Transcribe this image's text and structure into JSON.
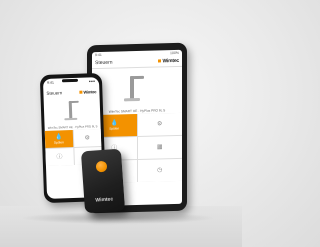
{
  "brand": {
    "name": "Wimtec",
    "accent": "#f39200"
  },
  "tablet": {
    "status_time": "9:41",
    "status_right": "100%",
    "title": "Steuern",
    "caption": "WimTec SMART HE · HyPlus PRO 6L S",
    "tiles": [
      {
        "label": "Spülen",
        "icon": "drop-icon"
      },
      {
        "label": "",
        "icon": "settings-icon"
      },
      {
        "label": "",
        "icon": "info-icon"
      },
      {
        "label": "",
        "icon": "chart-icon"
      }
    ]
  },
  "phone": {
    "status_time": "9:41",
    "status_right": "●●●",
    "title": "Steuern",
    "caption": "WimTec SMART HE · HyPlus PRO 6L S",
    "tiles": [
      {
        "label": "Spülen",
        "icon": "drop-icon"
      },
      {
        "label": "",
        "icon": "settings-icon"
      },
      {
        "label": "",
        "icon": "info-icon"
      },
      {
        "label": "",
        "icon": "chart-icon"
      }
    ]
  },
  "remote": {
    "brand": "Wimtec"
  }
}
